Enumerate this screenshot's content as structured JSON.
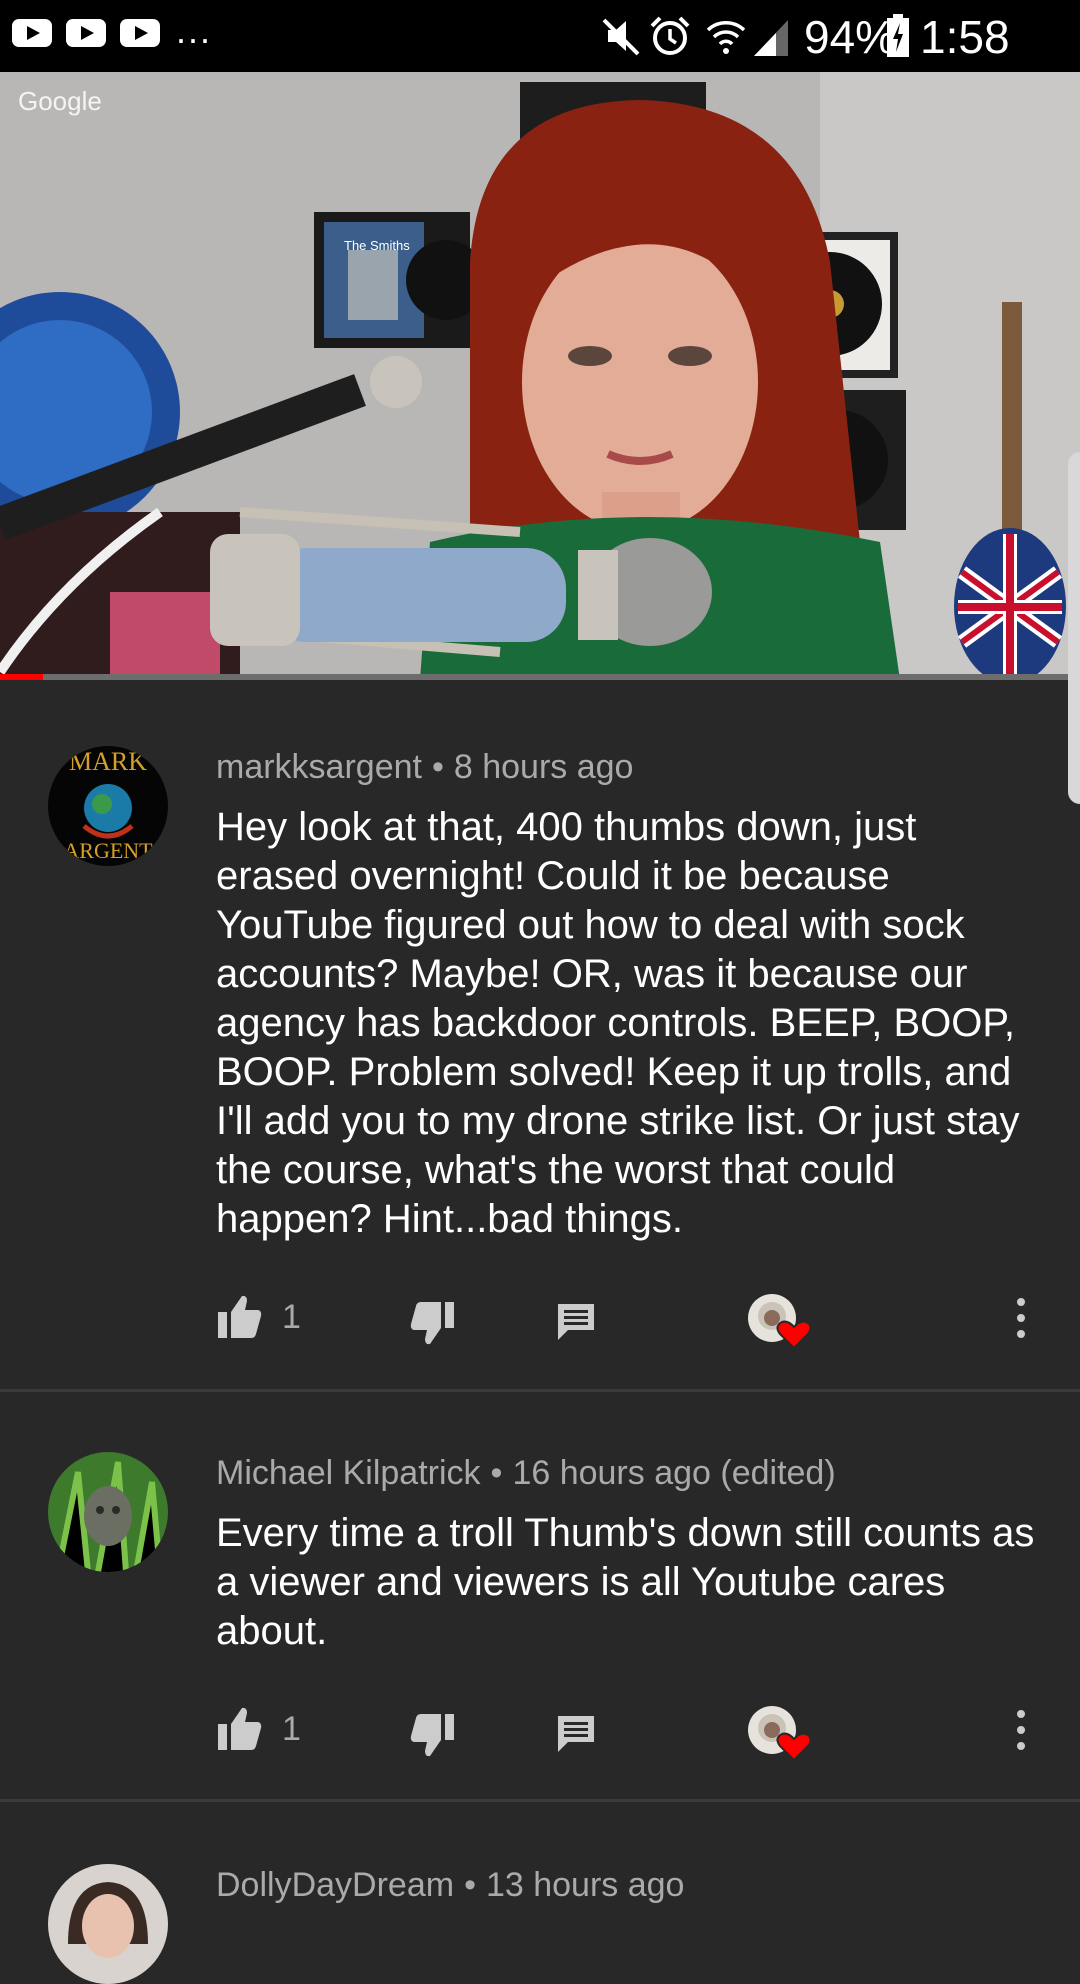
{
  "status_bar": {
    "notification_icons": [
      "youtube-icon",
      "youtube-icon",
      "youtube-icon"
    ],
    "more": "...",
    "system_icons": [
      "mute-icon",
      "alarm-icon",
      "wifi-icon",
      "signal-icon",
      "battery-charging-icon"
    ],
    "battery": "94%",
    "time": "1:58 pm"
  },
  "video": {
    "watermark": "Google",
    "album_label": "The Smiths",
    "progress": 0.04,
    "colors": {
      "progress": "#ff0000",
      "track": "#6d6d6d"
    }
  },
  "comments": [
    {
      "author": "markksargent",
      "time": "8 hours ago",
      "avatar_text_top": "MARK",
      "avatar_text_bottom": "ARGENT",
      "text": "Hey look at that, 400 thumbs down, just erased overnight! Could it be because YouTube figured out how to deal with sock accounts? Maybe! OR, was it because our agency has backdoor controls. BEEP, BOOP, BOOP. Problem solved! Keep it up trolls, and I'll add you to my drone strike list. Or just stay the course, what's the worst that could happen? Hint...bad things.",
      "likes": "1"
    },
    {
      "author": "Michael Kilpatrick",
      "time": "16 hours ago (edited)",
      "text": "Every time a troll  Thumb's down still counts as a viewer and viewers is all Youtube cares about.",
      "likes": "1"
    },
    {
      "author": "DollyDayDream",
      "time": "13 hours ago"
    }
  ],
  "colors": {
    "background": "#282828",
    "meta": "#aaaaaa",
    "heart": "#ff0000"
  }
}
